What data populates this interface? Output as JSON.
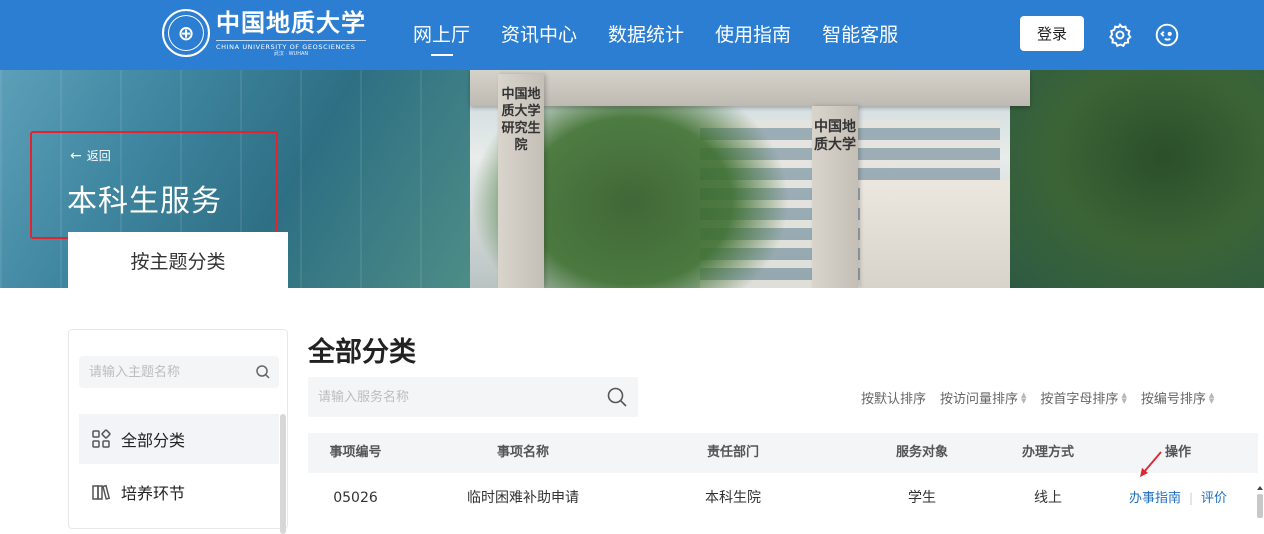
{
  "header": {
    "logo_cn": "中国地质大学",
    "logo_en": "CHINA UNIVERSITY OF GEOSCIENCES",
    "logo_sub": "武汉 · WUHAN",
    "nav": [
      {
        "label": "网上厅",
        "active": true
      },
      {
        "label": "资讯中心",
        "active": false
      },
      {
        "label": "数据统计",
        "active": false
      },
      {
        "label": "使用指南",
        "active": false
      },
      {
        "label": "智能客服",
        "active": false
      }
    ],
    "login_label": "登录",
    "icons": [
      "gear-icon",
      "chat-face-icon"
    ],
    "bar_color": "#2b7ed2"
  },
  "hero": {
    "back_label": "返回",
    "title": "本科生服务",
    "tab_label": "按主题分类",
    "gate_text_left": "中国地质大学研究生院",
    "gate_text_right": "中国地质大学",
    "highlight_color": "#e0252e"
  },
  "sidebar": {
    "search_placeholder": "请输入主题名称",
    "items": [
      {
        "label": "全部分类",
        "icon": "grid-icon",
        "active": true
      },
      {
        "label": "培养环节",
        "icon": "book-icon",
        "active": false
      }
    ]
  },
  "main": {
    "title": "全部分类",
    "search_placeholder": "请输入服务名称",
    "sorts": [
      "按默认排序",
      "按访问量排序",
      "按首字母排序",
      "按编号排序"
    ],
    "columns": [
      "事项编号",
      "事项名称",
      "责任部门",
      "服务对象",
      "办理方式",
      "操作"
    ],
    "rows": [
      {
        "code": "05026",
        "name": "临时困难补助申请",
        "dept": "本科生院",
        "target": "学生",
        "method": "线上",
        "op_guide": "办事指南",
        "op_rate": "评价"
      }
    ],
    "link_color": "#1f6fc1"
  }
}
